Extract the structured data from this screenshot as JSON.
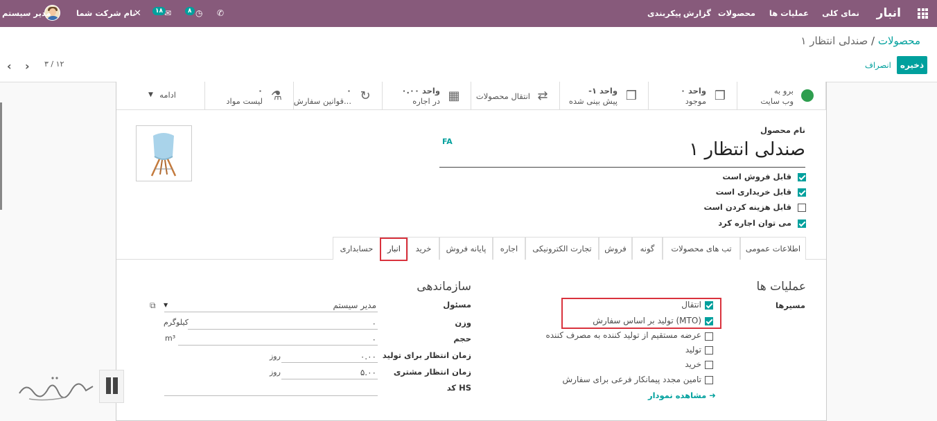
{
  "navbar": {
    "app_name": "انبار",
    "menus": [
      "نمای کلی",
      "عملیات ها",
      "محصولات",
      "گزارش",
      "پیکربندی"
    ],
    "activity_count": "۸",
    "messages_count": "۱۸",
    "company": "نام شرکت شما",
    "user": "مدیر سیستم",
    "brand_color": "#875a7b"
  },
  "breadcrumb": {
    "parent": "محصولات",
    "separator": "/",
    "current": "صندلی انتظار ۱"
  },
  "actions": {
    "save": "ذخیره",
    "discard": "انصراف"
  },
  "pager": "۳ / ۱۲",
  "stat_buttons": [
    {
      "line1": "برو به",
      "line2": "وب سایت",
      "icon": "globe-icon"
    },
    {
      "line1": "۰ واحد",
      "line2": "موجود",
      "icon": "cubes-icon"
    },
    {
      "line1": "-۱ واحد",
      "line2": "پیش بینی شده",
      "icon": "cubes-icon"
    },
    {
      "line1": "",
      "line2": "انتقال محصولات",
      "icon": "exchange-icon"
    },
    {
      "line1": "۰.۰۰ واحد",
      "line2": "در اجاره",
      "icon": "calendar-icon"
    },
    {
      "line1": "۰",
      "line2": "قوانین سفارش...",
      "icon": "refresh-icon"
    },
    {
      "line1": "۰",
      "line2": "لیست مواد",
      "icon": "flask-icon"
    },
    {
      "line1": "",
      "line2": "ادامه",
      "icon": "caret-down-icon"
    }
  ],
  "product": {
    "name_label": "نام محصول",
    "name": "صندلی انتظار ۱",
    "lang": "FA",
    "options": [
      {
        "label": "قابل فروش است",
        "checked": true
      },
      {
        "label": "قابل خریداری است",
        "checked": true
      },
      {
        "label": "قابل هزینه کردن است",
        "checked": false
      },
      {
        "label": "می توان اجاره کرد",
        "checked": true
      }
    ]
  },
  "tabs": [
    "اطلاعات عمومی",
    "تب های محصولات",
    "گونه",
    "فروش",
    "تجارت الکترونیکی",
    "اجاره",
    "پایانه فروش",
    "خرید",
    "انبار",
    "حسابداری"
  ],
  "active_tab": "انبار",
  "operations": {
    "title": "عملیات ها",
    "routes_label": "مسیرها",
    "routes": [
      {
        "label": "انتقال",
        "checked": true
      },
      {
        "label": "تولید بر اساس سفارش (MTO)",
        "checked": true
      },
      {
        "label": "عرضه مستقیم از تولید کننده به مصرف کننده",
        "checked": false
      },
      {
        "label": "تولید",
        "checked": false
      },
      {
        "label": "خرید",
        "checked": false
      },
      {
        "label": "تامین مجدد پیمانکار فرعی برای سفارش",
        "checked": false
      }
    ],
    "view_diagram": "مشاهده نمودار"
  },
  "logistics": {
    "title": "سازماندهی",
    "responsible_label": "مسئول",
    "responsible": "مدیر سیستم",
    "weight_label": "وزن",
    "weight": "۰",
    "weight_unit": "کیلوگرم",
    "volume_label": "حجم",
    "volume": "۰",
    "volume_unit": "m³",
    "mfg_lead_label": "زمان انتظار برای تولید",
    "mfg_lead": "۰.۰۰",
    "mfg_lead_unit": "روز",
    "cust_lead_label": "زمان انتظار مشتری",
    "cust_lead": "۵.۰۰",
    "cust_lead_unit": "روز",
    "hs_label": "کد HS",
    "hs": ""
  },
  "accent_color": "#00a09d",
  "highlight_color": "#d9323d"
}
